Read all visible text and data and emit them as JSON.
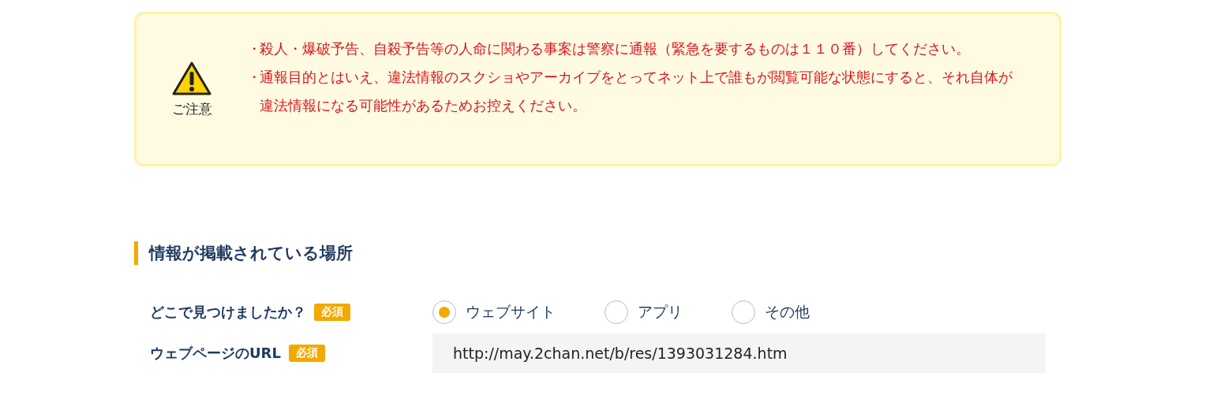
{
  "notice": {
    "label": "ご注意",
    "items": [
      "・",
      "・"
    ],
    "texts": [
      "殺人・爆破予告、自殺予告等の人命に関わる事案は警察に通報（緊急を要するものは１１０番）してください。",
      "通報目的とはいえ、違法情報のスクショやアーカイブをとってネット上で誰もが閲覧可能な状態にすると、それ自体が違法情報になる可能性があるためお控えください。"
    ]
  },
  "section": {
    "title": "情報が掲載されている場所"
  },
  "fields": [
    {
      "kind": "radio",
      "label": "どこで見つけましたか？",
      "badge": "必須",
      "options": [
        {
          "label": "ウェブサイト",
          "selected": true
        },
        {
          "label": "アプリ",
          "selected": false
        },
        {
          "label": "その他",
          "selected": false
        }
      ]
    },
    {
      "kind": "text",
      "label": "ウェブページのURL",
      "badge": "必須",
      "value": "http://may.2chan.net/b/res/1393031284.htm"
    }
  ]
}
